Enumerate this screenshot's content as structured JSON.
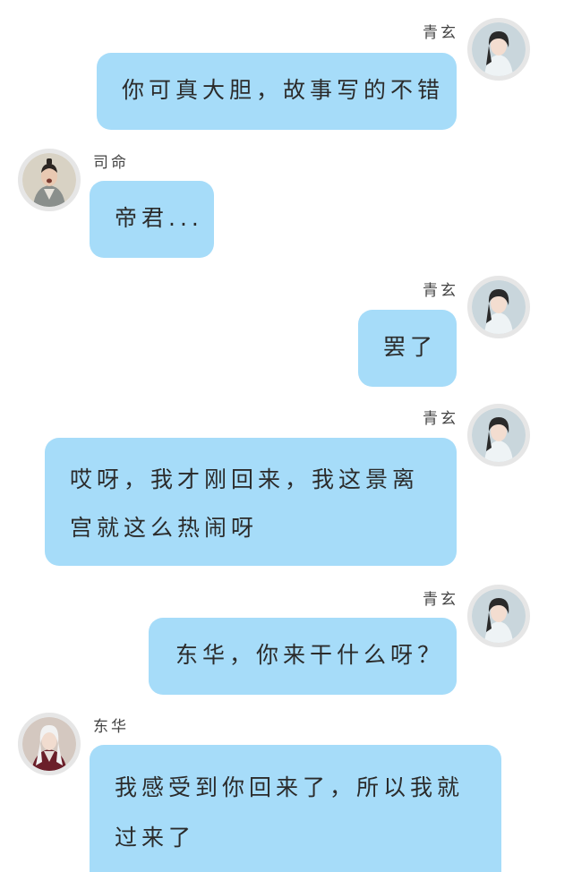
{
  "messages": [
    {
      "sender": "青玄",
      "side": "right",
      "lines": [
        "你可真大胆，故事写的不错"
      ]
    },
    {
      "sender": "司命",
      "side": "left",
      "lines": [
        "帝君..."
      ]
    },
    {
      "sender": "青玄",
      "side": "right",
      "lines": [
        "罢了"
      ]
    },
    {
      "sender": "青玄",
      "side": "right",
      "lines": [
        "哎呀，我才刚回来，我这景离",
        "宫就这么热闹呀"
      ]
    },
    {
      "sender": "青玄",
      "side": "right",
      "lines": [
        "东华，你来干什么呀？"
      ]
    },
    {
      "sender": "东华",
      "side": "left",
      "lines": [
        "我感受到你回来了，所以我就",
        "过来了"
      ]
    }
  ],
  "colors": {
    "bubble": "#a6dcf9",
    "avatar_ring": "#e6e6e6"
  },
  "avatars": [
    "qingxuan-avatar",
    "siming-avatar",
    "donghua-avatar"
  ]
}
